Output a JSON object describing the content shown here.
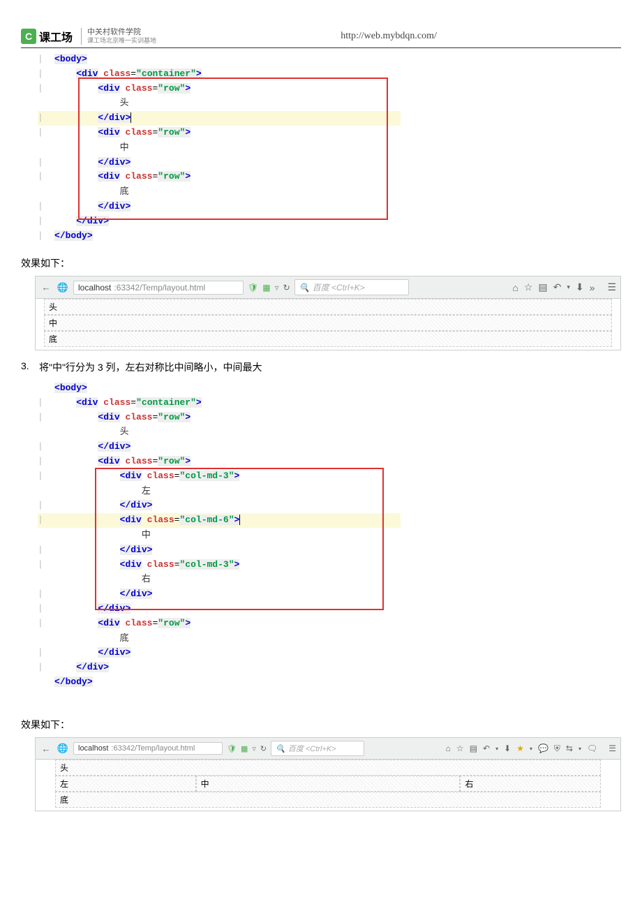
{
  "header": {
    "logo_text": "课工场",
    "logo_sub1": "中关村软件学院",
    "logo_sub2": "课工场北京唯一实训基地",
    "url": "http://web.mybdqn.com/"
  },
  "code1": {
    "body_open": "body",
    "container": "container",
    "row": "row",
    "text_head": "头",
    "text_mid": "中",
    "text_bottom": "底",
    "div": "div",
    "close_body": "/body",
    "close_div": "/div",
    "class_kw": "class"
  },
  "label_result": "效果如下：",
  "browser1": {
    "host": "localhost",
    "port_path": ":63342/Temp/layout.html",
    "search_placeholder": "百度 <Ctrl+K>",
    "rows": [
      "头",
      "中",
      "底"
    ]
  },
  "step3": {
    "num": "3.",
    "text": "将\"中\"行分为 3 列，左右对称比中间略小，中间最大"
  },
  "code2": {
    "col3": "col-md-3",
    "col6": "col-md-6",
    "left": "左",
    "mid": "中",
    "right": "右"
  },
  "browser2": {
    "rows_outer": [
      "头",
      "底"
    ],
    "cols": [
      "左",
      "中",
      "右"
    ]
  }
}
